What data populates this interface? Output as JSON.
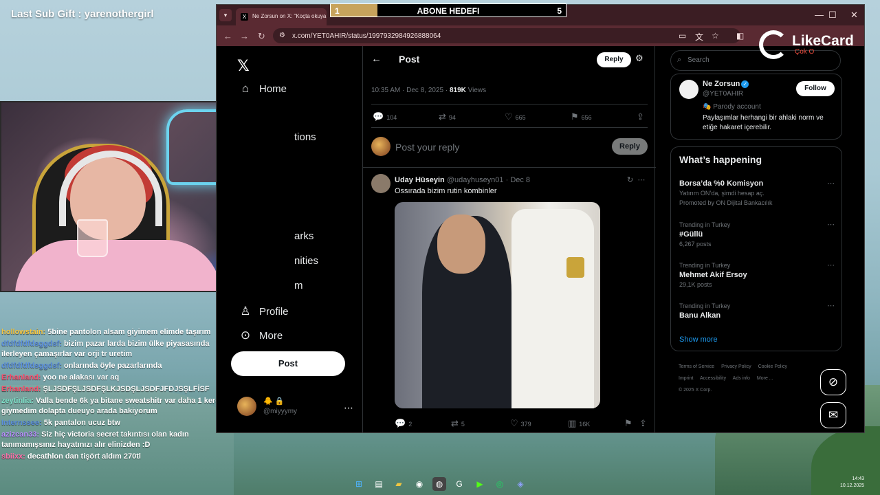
{
  "overlay": {
    "last_sub": "Last Sub Gift : yarenothergirl"
  },
  "goal": {
    "left": "1",
    "title": "ABONE HEDEFI",
    "right": "5",
    "progress": 0.2,
    "color": "#c7a35c"
  },
  "logo": {
    "text": "LikeCard",
    "sub": "Çok O"
  },
  "browser": {
    "tab_title": "Ne Zorsun on X: \"Koçta okuya",
    "url": "x.com/YET0AHIR/status/1997932984926888064"
  },
  "x": {
    "nav": [
      {
        "icon": "home-icon",
        "glyph": "⌂",
        "label": "Home"
      },
      {
        "icon": "bell-icon",
        "glyph": "🔔",
        "label": "tions"
      },
      {
        "icon": "bookmark-icon",
        "glyph": "🔖",
        "label": "arks"
      },
      {
        "icon": "communities-icon",
        "glyph": "👥",
        "label": "nities"
      },
      {
        "icon": "premium-icon",
        "glyph": "✦",
        "label": "m"
      },
      {
        "icon": "profile-icon",
        "glyph": "👤",
        "label": "Profile"
      },
      {
        "icon": "more-icon",
        "glyph": "⋯",
        "label": "More"
      }
    ],
    "post_button": "Post",
    "account": {
      "name": "🐥 🔒",
      "handle": "@miyyymy"
    },
    "header_title": "Post",
    "header_reply": "Reply",
    "meta": {
      "time": "10:35 AM · Dec 8, 2025 · ",
      "views_count": "819K",
      "views_label": " Views"
    },
    "post_actions": {
      "replies": "104",
      "reposts": "94",
      "likes": "665",
      "bookmarks": "656"
    },
    "reply_placeholder": "Post your reply",
    "reply_button": "Reply",
    "tweet": {
      "name": "Uday Hüseyin",
      "handle_date": "@udayhuseyn01 · Dec 8",
      "text": "Ossırada bizim rutin kombinler",
      "replies": "2",
      "reposts": "5",
      "likes": "379",
      "views": "16K"
    },
    "search_placeholder": "Search",
    "profile": {
      "name": "Ne Zorsun",
      "handle": "@YET0AHIR",
      "follow": "Follow",
      "parody": "Parody account",
      "bio": "Paylaşımlar herhangi bir ahlaki norm ve etiğe hakaret içerebilir."
    },
    "whats": {
      "title": "What’s happening",
      "trends": [
        {
          "topic": "Borsa’da %0 Komisyon",
          "line2": "Yatırım ON’da, şimdi hesap aç.",
          "line3": "Promoted by ON Dijital Bankacılık"
        },
        {
          "context": "Trending in Turkey",
          "topic": "#Güllü",
          "posts": "6,267 posts"
        },
        {
          "context": "Trending in Turkey",
          "topic": "Mehmet Akif Ersoy",
          "posts": "29,1K posts"
        },
        {
          "context": "Trending in Turkey",
          "topic": "Banu Alkan",
          "posts": ""
        }
      ],
      "show_more": "Show more"
    },
    "footer": {
      "tos": "Terms of Service",
      "privacy": "Privacy Policy",
      "cookie": "Cookie Policy",
      "imprint": "Imprint",
      "accessibility": "Accessibility",
      "ads": "Ads info",
      "more": "More ...",
      "copyright": "© 2025 X Corp."
    }
  },
  "chat": [
    {
      "user": "hollowstain:",
      "color": "#f4c542",
      "text": "5bine pantolon alsam giyimem elimde taşırım"
    },
    {
      "user": "dfdfdfdfdsggdsf:",
      "color": "#5b8fe0",
      "text": "bizim pazar larda bizim ülke piyasasında ilerleyen çamaşırlar var orji tr uretim"
    },
    {
      "user": "dfdfdfdfdsggdsf:",
      "color": "#5b8fe0",
      "text": "onlarında öyle pazarlarında"
    },
    {
      "user": "Erhanland:",
      "color": "#ff4d6d",
      "text": "yoo ne alakası var aq"
    },
    {
      "user": "Erhanland:",
      "color": "#ff4d6d",
      "text": "ŞLJSDFŞLJSDFŞLKJSDŞLJSDFJFDJSŞLFİSF"
    },
    {
      "user": "zeytinlia:",
      "color": "#7ee0c8",
      "text": "Valla bende 6k ya bitane sweatshitr var daha 1 kere giymedim dolapta dueuyo arada bakiyorum"
    },
    {
      "user": "Internssee:",
      "color": "#5b8fe0",
      "text": "5k pantalon ucuz btw"
    },
    {
      "user": "azizcan33:",
      "color": "#b98cff",
      "text": "Siz hiç victoria secret takıntısı olan kadın tanımamışsınız hayatınızı alır elinizden :D"
    },
    {
      "user": "sbiixx:",
      "color": "#ff6ea8",
      "text": "decathlon dan tişört aldım 270tl"
    }
  ],
  "clock": {
    "time": "14:43",
    "date": "10.12.2025"
  }
}
